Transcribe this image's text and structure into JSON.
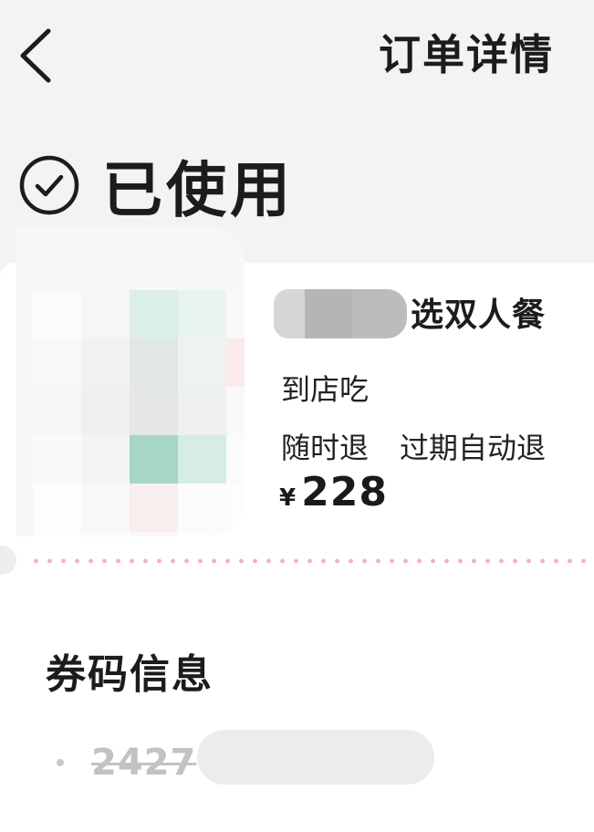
{
  "header": {
    "title": "订单详情",
    "back_icon": "chevron-left-icon"
  },
  "status": {
    "label": "已使用",
    "icon": "check-circle-icon"
  },
  "deal": {
    "title_suffix": "选双人餐",
    "dine_type": "到店吃",
    "refund_tags": [
      "随时退",
      "过期自动退"
    ],
    "currency_symbol": "¥",
    "price": "228"
  },
  "coupon": {
    "section_title": "券码信息",
    "code_visible": "2427"
  },
  "colors": {
    "background": "#f3f3f3",
    "card": "#ffffff",
    "divider_dots": "#f2b5b5",
    "code_used": "#c2c2c2",
    "text_primary": "#1c1c1c"
  }
}
